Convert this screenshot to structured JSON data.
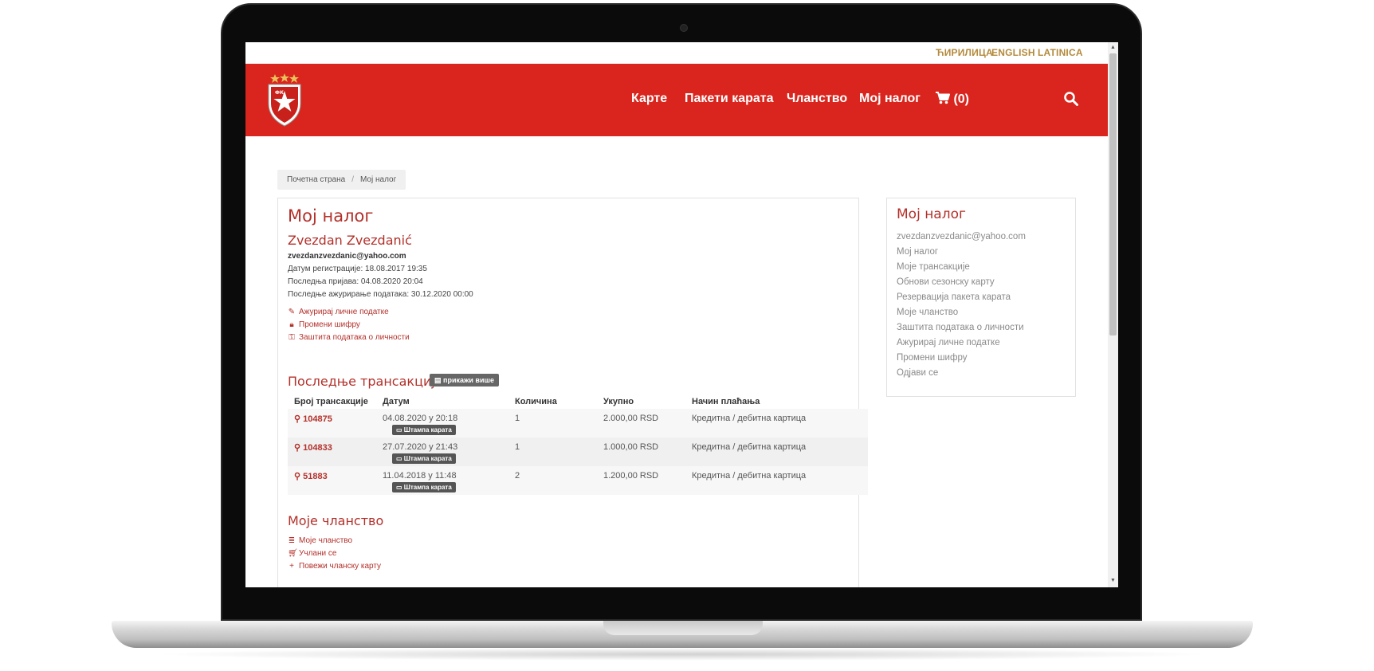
{
  "lang": [
    "ЋИРИЛИЦА",
    "ENGLISH",
    "LATINICA"
  ],
  "nav": {
    "tickets": "Карте",
    "packages": "Пакети карата",
    "membership": "Чланство",
    "account": "Мој налог",
    "cart": "(0)"
  },
  "breadcrumb": {
    "home": "Почетна страна",
    "sep": "/",
    "current": "Мој налог"
  },
  "main": {
    "title": "Мој налог",
    "user_name": "Zvezdan Zvezdanić",
    "email": "zvezdanzvezdanic@yahoo.com",
    "registered": "Датум регистрације: 18.08.2017 19:35",
    "last_login": "Последња пријава: 04.08.2020 20:04",
    "last_update": "Последње ажурирање података: 30.12.2020 00:00",
    "links": [
      "Ажурирај личне податке",
      "Промени шифру",
      "Заштита података о личности"
    ],
    "tx_title": "Последње трансакције",
    "tx_more": "прикажи више",
    "tx_headers": [
      "Број трансакције",
      "Датум",
      "Количина",
      "Укупно",
      "Начин плаћања"
    ],
    "tx_print": "Штампа карата",
    "transactions": [
      {
        "id": "104875",
        "date": "04.08.2020 у 20:18",
        "qty": "1",
        "total": "2.000,00 RSD",
        "payment": "Кредитна / дебитна картица"
      },
      {
        "id": "104833",
        "date": "27.07.2020 у 21:43",
        "qty": "1",
        "total": "1.000,00 RSD",
        "payment": "Кредитна / дебитна картица"
      },
      {
        "id": "51883",
        "date": "11.04.2018 у 11:48",
        "qty": "2",
        "total": "1.200,00 RSD",
        "payment": "Кредитна / дебитна картица"
      }
    ],
    "membership_title": "Моје чланство",
    "membership_links": [
      "Моје чланство",
      "Учлани се",
      "Повежи чланску карту"
    ]
  },
  "side": {
    "title": "Мој налог",
    "items": [
      "zvezdanzvezdanic@yahoo.com",
      "Мој налог",
      "Моје трансакције",
      "Обнови сезонску карту",
      "Резервација пакета карата",
      "Моје чланство",
      "Заштита података о личности",
      "Ажурирај личне податке",
      "Промени шифру",
      "Одјави се"
    ]
  },
  "colors": {
    "brand_red": "#d9251d",
    "accent_red": "#b3302a",
    "gold": "#b3893a"
  }
}
